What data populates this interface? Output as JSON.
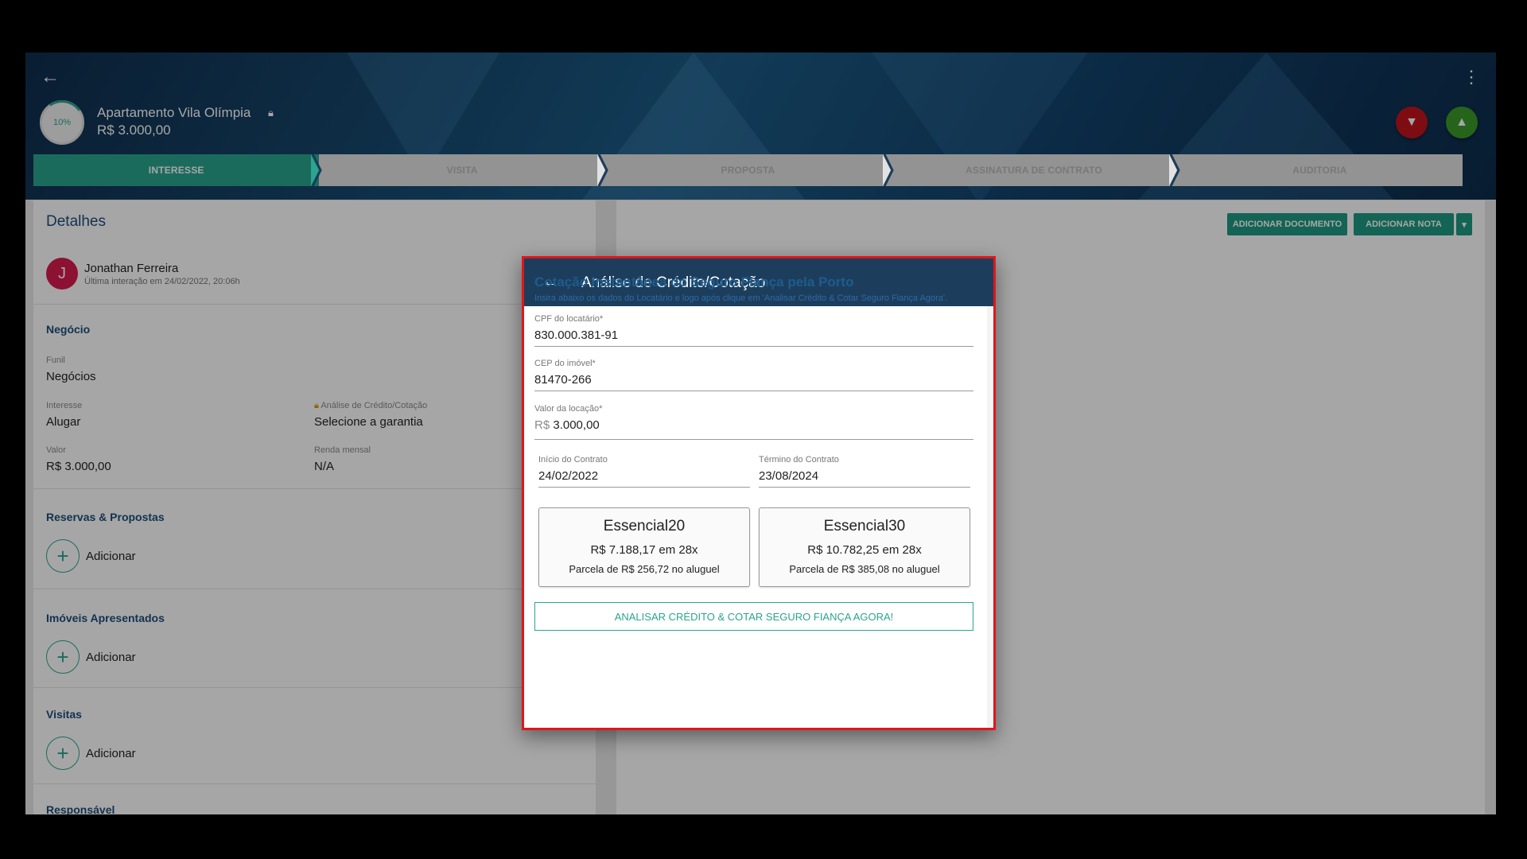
{
  "header": {
    "progress": "10%",
    "title": "Apartamento Vila Olímpia",
    "price": "R$ 3.000,00",
    "back_icon": "arrow-left-icon",
    "menu_icon": "kebab-icon",
    "dislike_color": "#c1151c",
    "like_color": "#3b9a2a"
  },
  "stepper": [
    "INTERESSE",
    "VISITA",
    "PROPOSTA",
    "ASSINATURA DE CONTRATO",
    "AUDITORIA"
  ],
  "left": {
    "title": "Detalhes",
    "contact": {
      "initial": "J",
      "name": "Jonathan Ferreira",
      "last": "Última interação em 24/02/2022, 20:06h"
    },
    "negocio": {
      "title": "Negócio",
      "funil_label": "Funil",
      "funil_value": "Negócios",
      "interesse_label": "Interesse",
      "interesse_value": "Alugar",
      "analise_label": "Análise de Crédito/Cotação",
      "analise_value": "Selecione a garantia",
      "valor_label": "Valor",
      "valor_value": "R$ 3.000,00",
      "renda_label": "Renda mensal",
      "renda_value": "N/A"
    },
    "reservas_title": "Reservas & Propostas",
    "imoveis_title": "Imóveis Apresentados",
    "visitas_title": "Visitas",
    "responsavel_title": "Responsável",
    "add_label": "Adicionar"
  },
  "right": {
    "add_doc": "ADICIONAR DOCUMENTO",
    "add_note": "ADICIONAR NOTA"
  },
  "modal": {
    "title": "Análise de Crédito/Cotação",
    "heading": "Cotação instantânea do Seguro Fiança pela Porto",
    "subheading": "Insira abaixo os dados do Locatário e logo após clique em 'Analisar Crédito & Cotar Seguro Fiança Agora'.",
    "cpf_label": "CPF do locatário*",
    "cpf_value": "830.000.381-91",
    "cep_label": "CEP do imóvel*",
    "cep_value": "81470-266",
    "valor_label": "Valor da locação*",
    "valor_currency": "R$",
    "valor_value": "3.000,00",
    "inicio_label": "Início do Contrato",
    "inicio_value": "24/02/2022",
    "termino_label": "Término do Contrato",
    "termino_value": "23/08/2024",
    "plans": [
      {
        "name": "Essencial20",
        "price": "R$ 7.188,17 em 28x",
        "parcel": "Parcela de R$ 256,72 no aluguel"
      },
      {
        "name": "Essencial30",
        "price": "R$ 10.782,25 em 28x",
        "parcel": "Parcela de R$ 385,08 no aluguel"
      }
    ],
    "cta": "ANALISAR CRÉDITO & COTAR SEGURO FIANÇA AGORA!"
  }
}
